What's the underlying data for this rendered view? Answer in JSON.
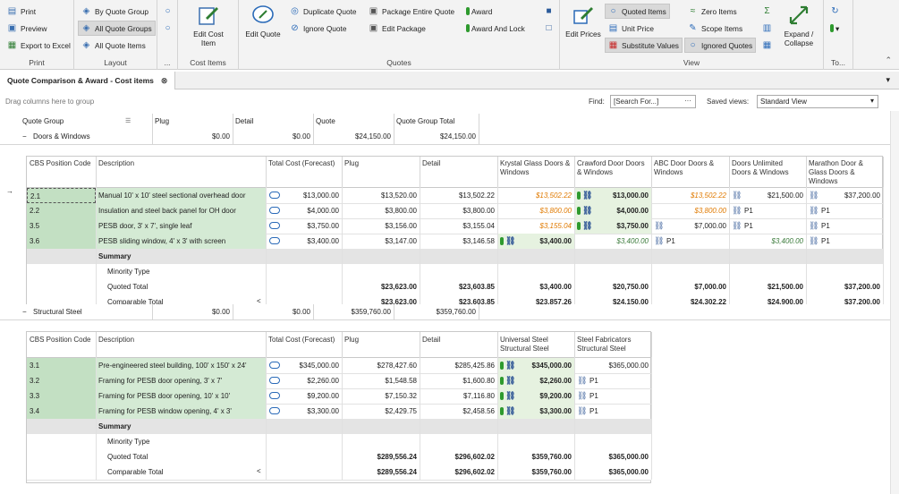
{
  "ribbon": {
    "print": {
      "print": "Print",
      "preview": "Preview",
      "export": "Export to Excel",
      "label": "Print"
    },
    "layout": {
      "by_group": "By Quote Group",
      "all_groups": "All Quote Groups",
      "all_items": "All Quote Items",
      "label": "Layout",
      "more": "..."
    },
    "cost_items": {
      "edit": "Edit Cost Item",
      "label": "Cost Items"
    },
    "quotes": {
      "edit_quote": "Edit Quote",
      "duplicate": "Duplicate Quote",
      "ignore": "Ignore Quote",
      "package_entire": "Package Entire Quote",
      "edit_package": "Edit Package",
      "award": "Award",
      "award_lock": "Award And Lock",
      "label": "Quotes"
    },
    "view": {
      "edit_prices": "Edit Prices",
      "quoted_items": "Quoted Items",
      "unit_price": "Unit Price",
      "substitute": "Substitute Values",
      "zero_items": "Zero Items",
      "scope_items": "Scope Items",
      "ignored_quotes": "Ignored Quotes",
      "expand": "Expand / Collapse",
      "label": "View"
    },
    "to": {
      "label": "To..."
    }
  },
  "tab": {
    "title": "Quote Comparison & Award - Cost items"
  },
  "toolbar": {
    "drag_hint": "Drag columns here to group",
    "find_label": "Find:",
    "find_placeholder": "[Search For...]",
    "saved_label": "Saved views:",
    "saved_value": "Standard View"
  },
  "group_header": {
    "c1": "Quote Group",
    "c2": "Plug",
    "c3": "Detail",
    "c4": "Quote",
    "c5": "Quote Group Total"
  },
  "groups": [
    {
      "name": "Doors & Windows",
      "plug": "$0.00",
      "detail": "$0.00",
      "quote": "$24,150.00",
      "total": "$24,150.00",
      "cols": [
        "CBS Position Code",
        "Description",
        "Total Cost (Forecast)",
        "Plug",
        "Detail",
        "Krystal Glass Doors & Windows",
        "Crawford Door Doors & Windows",
        "ABC Door Doors & Windows",
        "Doors Unlimited Doors & Windows",
        "Marathon Door & Glass Doors & Windows"
      ],
      "rows": [
        {
          "code": "2.1",
          "desc": "Manual 10' x 10' steel sectional overhead door",
          "total": "$13,000.00",
          "plug": "$13,520.00",
          "detail": "$13,502.22",
          "v": [
            "$13,502.22",
            "$13,000.00",
            "$13,502.22",
            "$21,500.00",
            "$37,200.00"
          ]
        },
        {
          "code": "2.2",
          "desc": "Insulation and steel back panel for OH door",
          "total": "$4,000.00",
          "plug": "$3,800.00",
          "detail": "$3,800.00",
          "v": [
            "$3,800.00",
            "$4,000.00",
            "$3,800.00",
            "P1",
            "P1"
          ]
        },
        {
          "code": "3.5",
          "desc": "PESB door, 3' x 7', single leaf",
          "total": "$3,750.00",
          "plug": "$3,156.00",
          "detail": "$3,155.04",
          "v": [
            "$3,155.04",
            "$3,750.00",
            "$7,000.00",
            "P1",
            "P1"
          ]
        },
        {
          "code": "3.6",
          "desc": "PESB sliding window, 4' x 3' with screen",
          "total": "$3,400.00",
          "plug": "$3,147.00",
          "detail": "$3,146.58",
          "v": [
            "$3,400.00",
            "$3,400.00",
            "P1",
            "$3,400.00",
            "P1"
          ]
        }
      ],
      "summary": {
        "label": "Summary",
        "minority": "Minority Type",
        "quoted": "Quoted Total",
        "comparable": "Comparable Total",
        "quoted_vals": [
          "$23,623.00",
          "$23,603.85",
          "$3,400.00",
          "$20,750.00",
          "$7,000.00",
          "$21,500.00",
          "$37,200.00"
        ],
        "comp_vals": [
          "$23,623.00",
          "$23,603.85",
          "$23,857.26",
          "$24,150.00",
          "$24,302.22",
          "$24,900.00",
          "$37,200.00"
        ]
      }
    },
    {
      "name": "Structural Steel",
      "plug": "$0.00",
      "detail": "$0.00",
      "quote": "$359,760.00",
      "total": "$359,760.00",
      "cols": [
        "CBS Position Code",
        "Description",
        "Total Cost (Forecast)",
        "Plug",
        "Detail",
        "Universal Steel Structural Steel",
        "Steel Fabricators Structural Steel"
      ],
      "rows": [
        {
          "code": "3.1",
          "desc": "Pre-engineered steel building, 100' x 150' x 24'",
          "total": "$345,000.00",
          "plug": "$278,427.60",
          "detail": "$285,425.86",
          "v": [
            "$345,000.00",
            "$365,000.00"
          ]
        },
        {
          "code": "3.2",
          "desc": "Framing for PESB door opening, 3' x 7'",
          "total": "$2,260.00",
          "plug": "$1,548.58",
          "detail": "$1,600.80",
          "v": [
            "$2,260.00",
            "P1"
          ]
        },
        {
          "code": "3.3",
          "desc": "Framing for PESB door opening, 10' x 10'",
          "total": "$9,200.00",
          "plug": "$7,150.32",
          "detail": "$7,116.80",
          "v": [
            "$9,200.00",
            "P1"
          ]
        },
        {
          "code": "3.4",
          "desc": "Framing for PESB window opening, 4' x 3'",
          "total": "$3,300.00",
          "plug": "$2,429.75",
          "detail": "$2,458.56",
          "v": [
            "$3,300.00",
            "P1"
          ]
        }
      ],
      "summary": {
        "label": "Summary",
        "minority": "Minority Type",
        "quoted": "Quoted Total",
        "comparable": "Comparable Total",
        "quoted_vals": [
          "$289,556.24",
          "$296,602.02",
          "$359,760.00",
          "$365,000.00"
        ],
        "comp_vals": [
          "$289,556.24",
          "$296,602.02",
          "$359,760.00",
          "$365,000.00"
        ]
      }
    }
  ]
}
